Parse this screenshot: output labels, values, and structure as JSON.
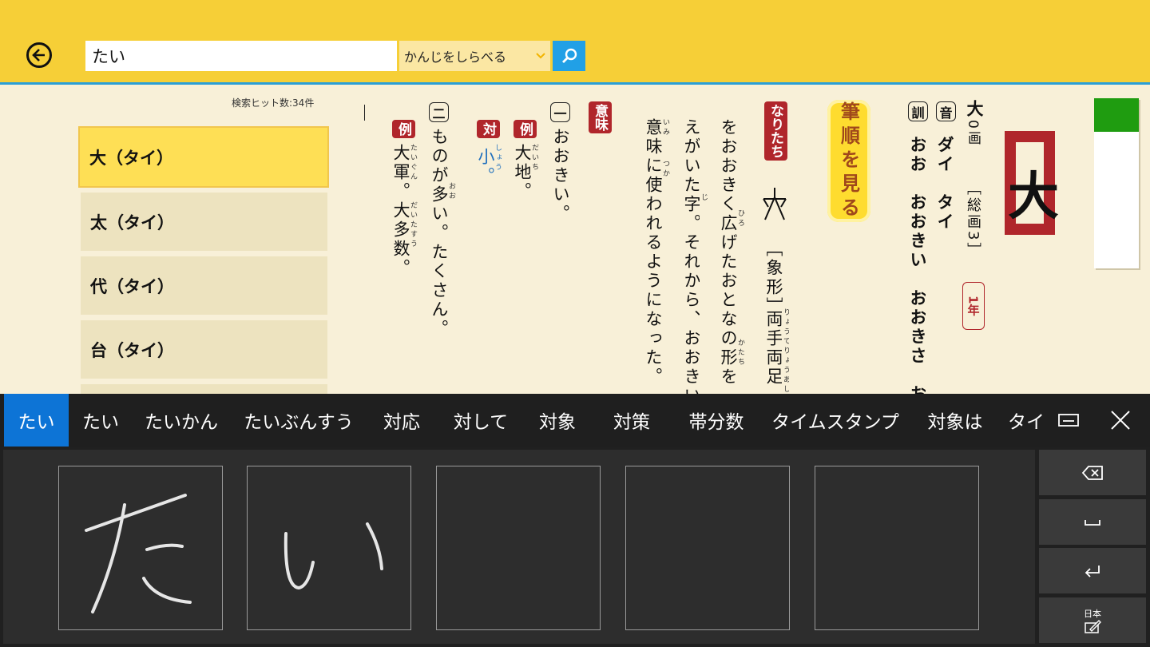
{
  "search": {
    "value": "たい",
    "mode_label": "かんじをしらべる"
  },
  "results": {
    "count_label": "検索ヒット数:34件",
    "items": [
      {
        "label": "大（タイ）"
      },
      {
        "label": "太（タイ）"
      },
      {
        "label": "代（タイ）"
      },
      {
        "label": "台（タイ）"
      }
    ]
  },
  "entry": {
    "kanji": "大",
    "strokes_head": "大",
    "strokes_line": "0画",
    "total_strokes": "［総画3］",
    "grade": "1年",
    "on_label": "音",
    "on_reading": "ダイ　タイ",
    "kun_label": "訓",
    "kun_reading": "おお　おおきい　おおきさ　お",
    "stroke_order_button": "筆順を見る",
    "origin_tag": "なりたち",
    "origin_type": "［象形］",
    "origin_line1": "両手両足",
    "origin_line2": "をおおきく広げたおとなの形を",
    "origin_line3": "えがいた字。それから、おおきい",
    "origin_line4": "意味に使われるようになった。",
    "meaning_tag": "意味",
    "m1_num": "一",
    "m1_text": "おおきい。",
    "m1_ex_tag": "例",
    "m1_ex": "大地。",
    "m1_opp_tag": "対",
    "m1_opp": "小。",
    "m2_num": "二",
    "m2_text": "ものが多い。たくさん。",
    "m2_ex_tag": "例",
    "m2_ex": "大軍。大多数。",
    "ruby_hiro": "ひろ",
    "ruby_katachi": "かたち",
    "ruby_ji": "じ",
    "ruby_imi": "いみ",
    "ruby_tsuka": "つか",
    "ruby_ryoute": "りょうてりょうあし",
    "ruby_daichi": "だいち",
    "ruby_shou": "しょう",
    "ruby_oo": "おお",
    "ruby_taigun": "たいぐん",
    "ruby_daitasuu": "だいたすう"
  },
  "ime": {
    "suggestions": [
      "たい",
      "たい",
      "たいかん",
      "たいぶんすう",
      "対応",
      "対して",
      "対象",
      "対策",
      "帯分数",
      "タイムスタンプ",
      "対象は",
      "タイ"
    ],
    "sample_1": "た",
    "sample_2": "い",
    "lang_label": "日本"
  },
  "colors": {
    "topbar": "#f6cf37",
    "accent_blue": "#21a0e6",
    "tag_red": "#b0262b",
    "selection_yellow": "#fedf55",
    "ime_select": "#0d74d6"
  }
}
